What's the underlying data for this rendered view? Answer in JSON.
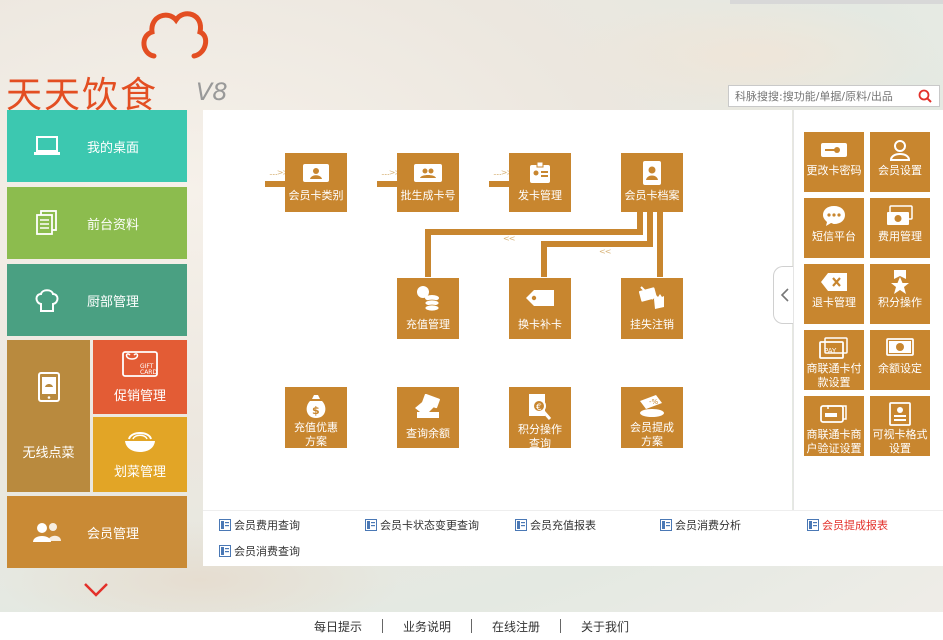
{
  "logo": {
    "brand": "天天饮食",
    "version": "V8"
  },
  "search": {
    "placeholder": "科脉搜搜:搜功能/单据/原料/出品"
  },
  "nav": {
    "desktop": "我的桌面",
    "front": "前台资料",
    "kitchen": "厨部管理",
    "wireless": "无线点菜",
    "promo": "促销管理",
    "plan": "划菜管理",
    "member": "会员管理"
  },
  "flow": {
    "card_type": "会员卡类别",
    "batch_gen": "批生成卡号",
    "issue": "发卡管理",
    "archive": "会员卡档案",
    "recharge": "充值管理",
    "replace": "换卡补卡",
    "lost": "挂失注销",
    "recharge_promo": "充值优惠\n方案",
    "balance_query": "查询余额",
    "points_query": "积分操作\n查询",
    "commission_plan": "会员提成\n方案"
  },
  "side": {
    "change_pwd": "更改卡密码",
    "member_settings": "会员设置",
    "sms": "短信平台",
    "fee": "费用管理",
    "refund": "退卡管理",
    "points": "积分操作",
    "unionpay_pay": "商联通卡付\n款设置",
    "balance_set": "余额设定",
    "unionpay_verify": "商联通卡商\n户验证设置",
    "visual_format": "可视卡格式\n设置"
  },
  "reports": {
    "r1": "会员费用查询",
    "r2": "会员卡状态变更查询",
    "r3": "会员充值报表",
    "r4": "会员消费分析",
    "r5": "会员提成报表",
    "r6": "会员消费查询"
  },
  "footer": {
    "tips": "每日提示",
    "business": "业务说明",
    "register": "在线注册",
    "about": "关于我们"
  },
  "colors": {
    "accent": "#c8862f",
    "teal": "#3cc8b0",
    "green": "#8cbc4e",
    "darkgreen": "#4aa082",
    "orange": "#e35c35",
    "yellow": "#e2a526",
    "brand_red": "#e34e22",
    "highlight": "#e3302a"
  }
}
